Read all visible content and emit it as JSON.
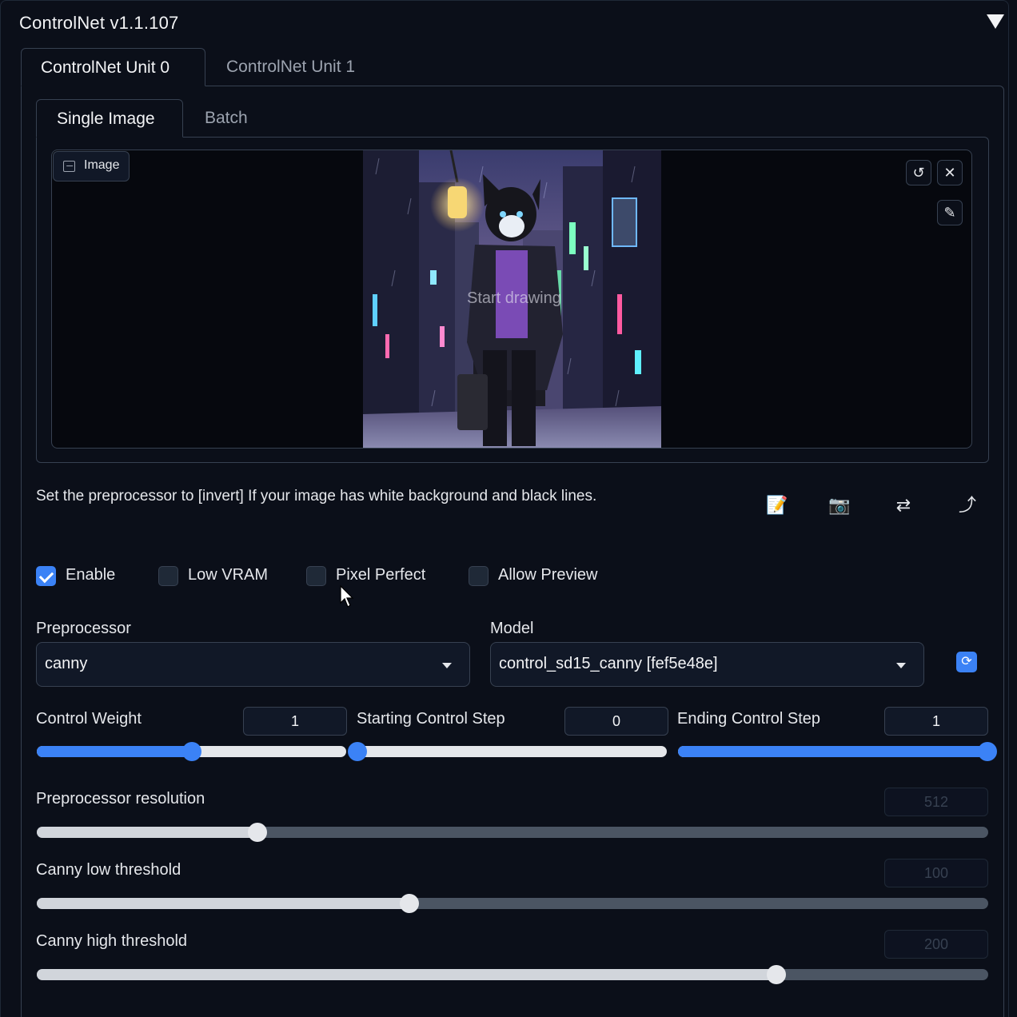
{
  "panel": {
    "title": "ControlNet v1.1.107"
  },
  "unit_tabs": [
    {
      "label": "ControlNet Unit 0",
      "active": true
    },
    {
      "label": "ControlNet Unit 1",
      "active": false
    }
  ],
  "image_tabs": [
    {
      "label": "Single Image",
      "active": true
    },
    {
      "label": "Batch",
      "active": false
    }
  ],
  "image_input": {
    "label": "Image",
    "draw_hint": "Start drawing",
    "tools": [
      "undo-icon",
      "close-icon",
      "brush-icon"
    ]
  },
  "hint": "Set the preprocessor to [invert] If your image has white background and black lines.",
  "actions": [
    "new-canvas-icon",
    "camera-icon",
    "swap-icon",
    "send-dimensions-icon"
  ],
  "checkboxes": [
    {
      "label": "Enable",
      "checked": true
    },
    {
      "label": "Low VRAM",
      "checked": false
    },
    {
      "label": "Pixel Perfect",
      "checked": false
    },
    {
      "label": "Allow Preview",
      "checked": false
    }
  ],
  "preprocessor": {
    "label": "Preprocessor",
    "value": "canny"
  },
  "model": {
    "label": "Model",
    "value": "control_sd15_canny [fef5e48e]"
  },
  "sliders": {
    "control_weight": {
      "label": "Control Weight",
      "value": "1",
      "fraction": 0.5
    },
    "starting_step": {
      "label": "Starting Control Step",
      "value": "0",
      "fraction": 0.0
    },
    "ending_step": {
      "label": "Ending Control Step",
      "value": "1",
      "fraction": 1.0
    },
    "preprocessor_resolution": {
      "label": "Preprocessor resolution",
      "value": "512",
      "fraction": 0.232
    },
    "canny_low": {
      "label": "Canny low threshold",
      "value": "100",
      "fraction": 0.392
    },
    "canny_high": {
      "label": "Canny high threshold",
      "value": "200",
      "fraction": 0.777
    }
  },
  "colors": {
    "accent": "#3b82f6",
    "background": "#0b0f19",
    "border": "#374151"
  }
}
